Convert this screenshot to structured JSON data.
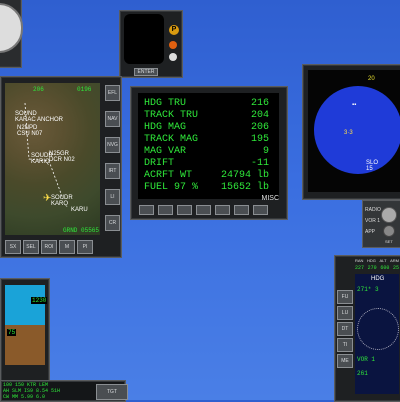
{
  "mini_display": {
    "enter_label": "ENTER",
    "p_label": "P"
  },
  "map": {
    "range": "206",
    "time": "0196",
    "wpt1": "N2NPD",
    "wpt1b": "CSU N07",
    "wpt2": "SOUND",
    "wpt2b": "KARAC ANCHOR",
    "wpt3": "N25GR",
    "wpt3b": "DCR N02",
    "wpt4": "SOUDR",
    "wpt4b": "KARIQ",
    "wpt5": "SOUDR",
    "wpt5b": "KARQ",
    "wpt6": "KARU",
    "gs": "GRND 05565",
    "side_buttons": [
      "EFL",
      "NAV",
      "NVG",
      "IRT",
      "LI",
      "CR"
    ],
    "bottom_buttons": [
      "SX",
      "SEL",
      "ROI",
      "M",
      "PI"
    ],
    "tgt_label": "TGT"
  },
  "cdu": {
    "rows": [
      {
        "label": "HDG TRU",
        "value": "216"
      },
      {
        "label": "TRACK TRU",
        "value": "204"
      },
      {
        "label": "HDG MAG",
        "value": "206"
      },
      {
        "label": "TRACK MAG",
        "value": "195"
      },
      {
        "label": "MAG VAR",
        "value": "9"
      },
      {
        "label": "DRIFT",
        "value": "-11"
      },
      {
        "label": "ACRFT WT",
        "value": "24794 lb"
      },
      {
        "label": "FUEL 97 %",
        "value": "15652 lb"
      }
    ],
    "page_label": "MISC"
  },
  "radar": {
    "top_label": "20",
    "contact1": "3·3",
    "contact2": "SLO",
    "contact3": "15"
  },
  "radio": {
    "radio_label": "RADIO",
    "vor_label": "VOR 1",
    "app_label": "APP",
    "set_label": "SET"
  },
  "pfd_left": {
    "alt": "1230",
    "speed": "75"
  },
  "pfd_right": {
    "header": [
      "RAN",
      "HDG",
      "ALT",
      "ARM"
    ],
    "values": [
      "227",
      "270",
      "600",
      "25"
    ],
    "hdg": "HDG",
    "readout1": "271* 3",
    "vor": "VOR 1",
    "heading": "261",
    "side_buttons": [
      "FU",
      "LU",
      "DT",
      "TI",
      "ME"
    ]
  },
  "status": {
    "row1": "100  150  KTR  LEM",
    "row2": "AH  SLM  IS9  8.54  51H",
    "row3": "CW  MM  5.99  6.0",
    "tgt": "TGT"
  },
  "colors": {
    "desktop": "#3a6ee0",
    "screen_text": "#2fe83a",
    "radar_blue": "#1f3bd8",
    "bezel": "#1e2022"
  }
}
